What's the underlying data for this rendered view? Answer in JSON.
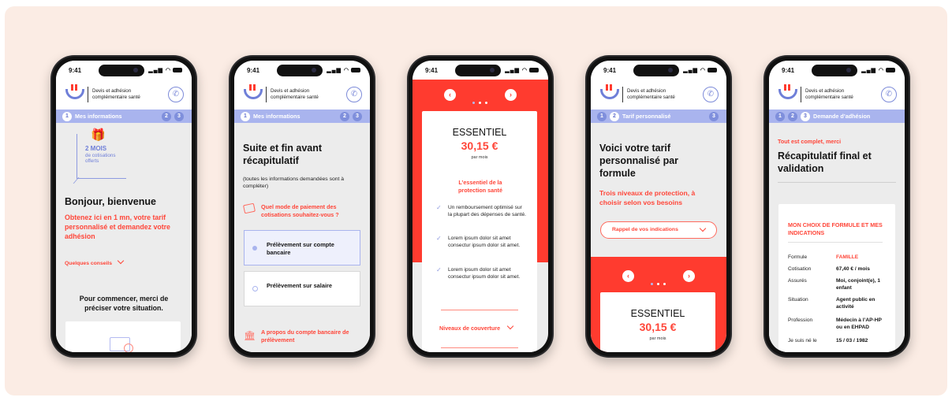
{
  "common": {
    "time": "9:41",
    "status_icons": "▂▄▆ ◠",
    "header_title": "Devis et adhésion complémentaire santé",
    "phone_icon": "✆"
  },
  "phone1": {
    "steps": [
      "1",
      "2",
      "3"
    ],
    "step_label": "Mes informations",
    "promo_title": "2 MOIS",
    "promo_sub": "de cotisations offerts",
    "greeting": "Bonjour, bienvenue",
    "intro": "Obtenez ici en 1 mn, votre tarif personnalisé et demandez votre adhésion",
    "tips_link": "Quelques conseils",
    "start_text": "Pour commencer, merci de préciser votre situation."
  },
  "phone2": {
    "steps": [
      "1",
      "2",
      "3"
    ],
    "step_label": "Mes informations",
    "title": "Suite et fin avant récapitulatif",
    "subtitle": "(toutes les informations demandées sont à compléter)",
    "question": "Quel mode de paiement des cotisations souhaitez-vous ?",
    "options": [
      "Prélèvement sur compte bancaire",
      "Prélèvement sur salaire"
    ],
    "bank_section": "A propos du compte bancaire de prélèvement"
  },
  "phone3": {
    "plan_name": "ESSENTIEL",
    "price": "30,15 €",
    "period": "par mois",
    "plan_desc": "L’essentiel de la protection santé",
    "benefits": [
      "Un remboursement optimisé sur la plupart des dépenses de santé.",
      "Lorem ipsum dolor sit amet consectur ipsum dolor sit amet.",
      "Lorem ipsum dolor sit amet consectur ipsum dolor sit amet."
    ],
    "coverage_link": "Niveaux de couverture"
  },
  "phone4": {
    "steps": [
      "1",
      "2",
      "3"
    ],
    "step_label": "Tarif personnalisé",
    "title": "Voici votre tarif personnalisé par formule",
    "subtitle": "Trois niveaux de protection, à choisir selon vos besoins",
    "recall_button": "Rappel de vos indications",
    "plan_name": "ESSENTIEL",
    "price": "30,15 €",
    "period": "par mois"
  },
  "phone5": {
    "steps": [
      "1",
      "2",
      "3"
    ],
    "step_label": "Demande d’adhésion",
    "kicker": "Tout est complet, merci",
    "title": "Récapitulatif final et validation",
    "section_title": "MON CHOIX DE FORMULE ET MES INDICATIONS",
    "rows": [
      {
        "label": "Formule",
        "value": "FAMILLE"
      },
      {
        "label": "Cotisation",
        "value": "67,40 € / mois"
      },
      {
        "label": "Assurés",
        "value": "Moi, conjoint(e), 1 enfant"
      },
      {
        "label": "Situation",
        "value": "Agent public en activité"
      },
      {
        "label": "Profession",
        "value": "Médecin à l’AP-HP ou en EHPAD"
      },
      {
        "label": "Je suis né le",
        "value": "15 / 03 / 1982"
      }
    ]
  },
  "colors": {
    "brand_red": "#ff3b2f",
    "brand_blue": "#6f7fd8",
    "step_bar": "#a9b4ee",
    "background": "#fbece4"
  }
}
